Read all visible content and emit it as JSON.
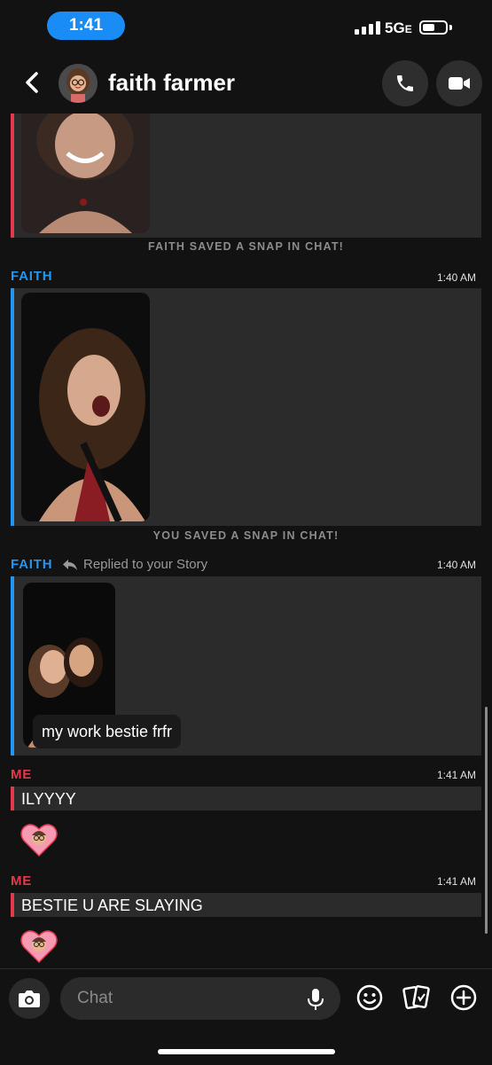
{
  "status_bar": {
    "time": "1:41",
    "network": "5G",
    "network_suffix": "E"
  },
  "header": {
    "contact_name": "faith farmer",
    "icons": [
      "back-chevron-icon",
      "bitmoji-avatar",
      "phone-icon",
      "video-camera-icon"
    ]
  },
  "messages": [
    {
      "type": "snap",
      "sender": "",
      "note": "FAITH SAVED A SNAP IN CHAT!"
    },
    {
      "type": "snap",
      "sender": "FAITH",
      "time": "1:40 AM",
      "note": "YOU SAVED A SNAP IN CHAT!"
    },
    {
      "type": "story-reply",
      "sender": "FAITH",
      "reply_label": "Replied to your Story",
      "time": "1:40 AM",
      "caption": "my work bestie frfr"
    },
    {
      "type": "text",
      "sender": "ME",
      "time": "1:41 AM",
      "text": "ILYYYY"
    },
    {
      "type": "text",
      "sender": "ME",
      "time": "1:41 AM",
      "text": "BESTIE U ARE SLAYING"
    }
  ],
  "input_bar": {
    "placeholder": "Chat",
    "icons": [
      "camera-icon",
      "microphone-icon",
      "smiley-icon",
      "cards-icon",
      "plus-circle-icon"
    ]
  },
  "colors": {
    "faith": "#2196f3",
    "me": "#e2394d",
    "status_pill": "#1a8cf5",
    "background": "#121212",
    "card": "#2b2b2b"
  }
}
